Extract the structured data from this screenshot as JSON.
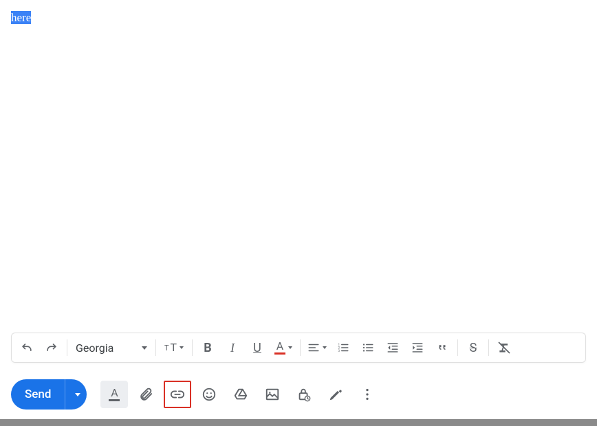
{
  "editor": {
    "selected_text": "here"
  },
  "format_toolbar": {
    "font_family": "Georgia"
  },
  "actions": {
    "send_label": "Send"
  }
}
